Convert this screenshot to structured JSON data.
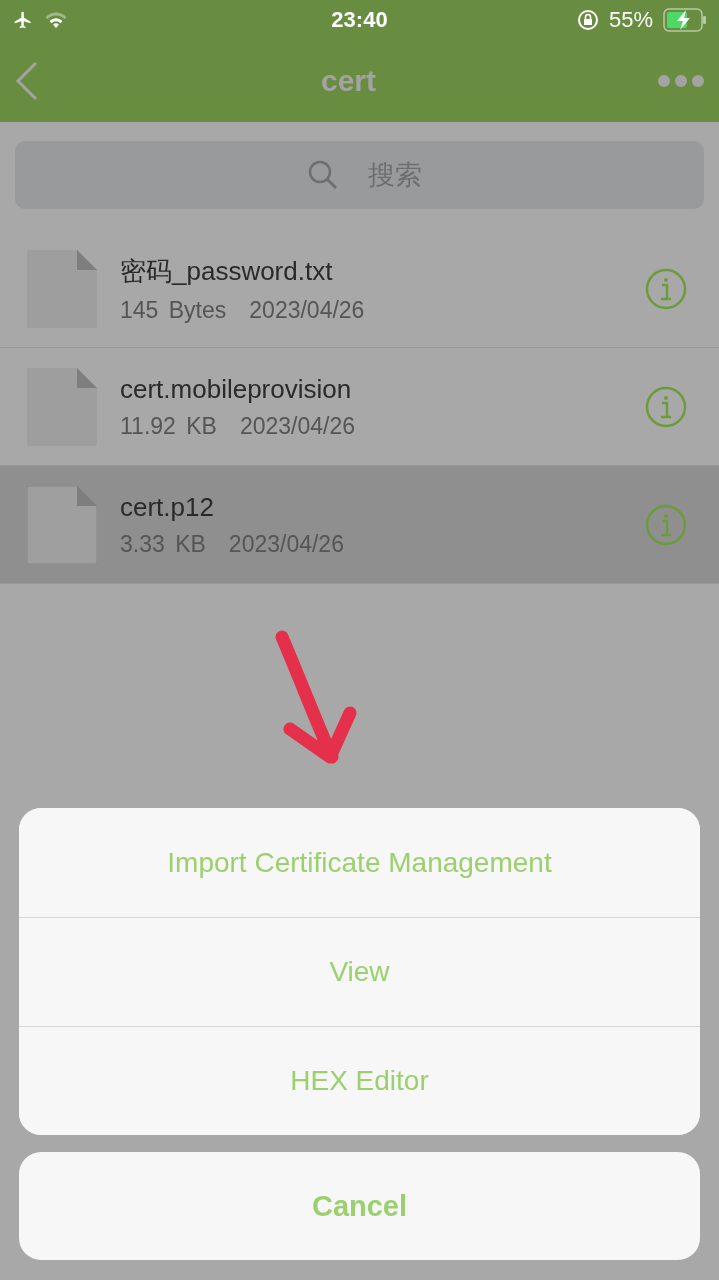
{
  "status_bar": {
    "time": "23:40",
    "battery": "55%"
  },
  "nav": {
    "title": "cert"
  },
  "search": {
    "placeholder": "搜索"
  },
  "files": [
    {
      "name": "密码_password.txt",
      "size": "145 Bytes",
      "date": "2023/04/26",
      "selected": false
    },
    {
      "name": "cert.mobileprovision",
      "size": "11.92 KB",
      "date": "2023/04/26",
      "selected": false
    },
    {
      "name": "cert.p12",
      "size": "3.33 KB",
      "date": "2023/04/26",
      "selected": true
    }
  ],
  "action_sheet": {
    "actions": [
      "Import Certificate Management",
      "View",
      "HEX Editor"
    ],
    "cancel": "Cancel"
  }
}
